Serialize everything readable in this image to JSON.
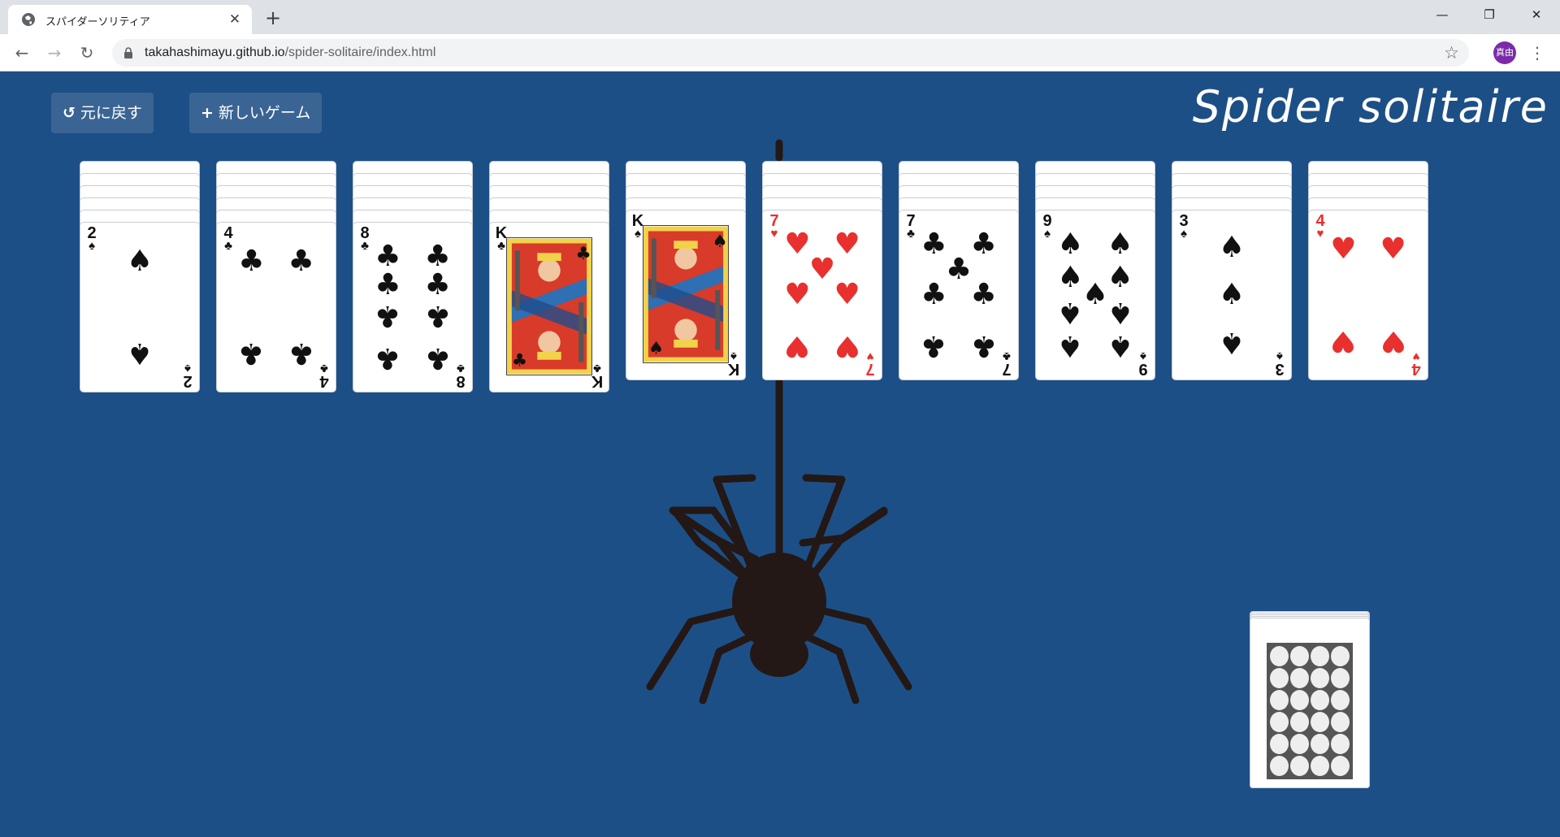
{
  "browser": {
    "tab_title": "スパイダーソリティア",
    "tab_close": "✕",
    "new_tab": "+",
    "url_host": "takahashimayu.github.io",
    "url_path": "/spider-solitaire/index.html",
    "avatar_text": "真由",
    "window_controls": {
      "minimize": "—",
      "restore": "❐",
      "close": "✕"
    }
  },
  "game": {
    "title": "Spider solitaire",
    "undo_icon": "↺",
    "undo_label": "元に戻す",
    "new_game_icon": "+",
    "new_game_label": "新しいゲーム"
  },
  "piles": [
    {
      "hidden": 5,
      "rank": "2",
      "suit": "♠",
      "color": "black"
    },
    {
      "hidden": 5,
      "rank": "4",
      "suit": "♣",
      "color": "black"
    },
    {
      "hidden": 5,
      "rank": "8",
      "suit": "♣",
      "color": "black"
    },
    {
      "hidden": 5,
      "rank": "K",
      "suit": "♣",
      "color": "black"
    },
    {
      "hidden": 4,
      "rank": "K",
      "suit": "♠",
      "color": "black"
    },
    {
      "hidden": 4,
      "rank": "7",
      "suit": "♥",
      "color": "red"
    },
    {
      "hidden": 4,
      "rank": "7",
      "suit": "♣",
      "color": "black"
    },
    {
      "hidden": 4,
      "rank": "9",
      "suit": "♠",
      "color": "black"
    },
    {
      "hidden": 4,
      "rank": "3",
      "suit": "♠",
      "color": "black"
    },
    {
      "hidden": 4,
      "rank": "4",
      "suit": "♥",
      "color": "red"
    }
  ],
  "stock": {
    "remaining_deals": 5
  },
  "colors": {
    "table": "#1d4f87",
    "button": "#3a6493",
    "red_suit": "#e8302f",
    "spider": "#231815"
  }
}
